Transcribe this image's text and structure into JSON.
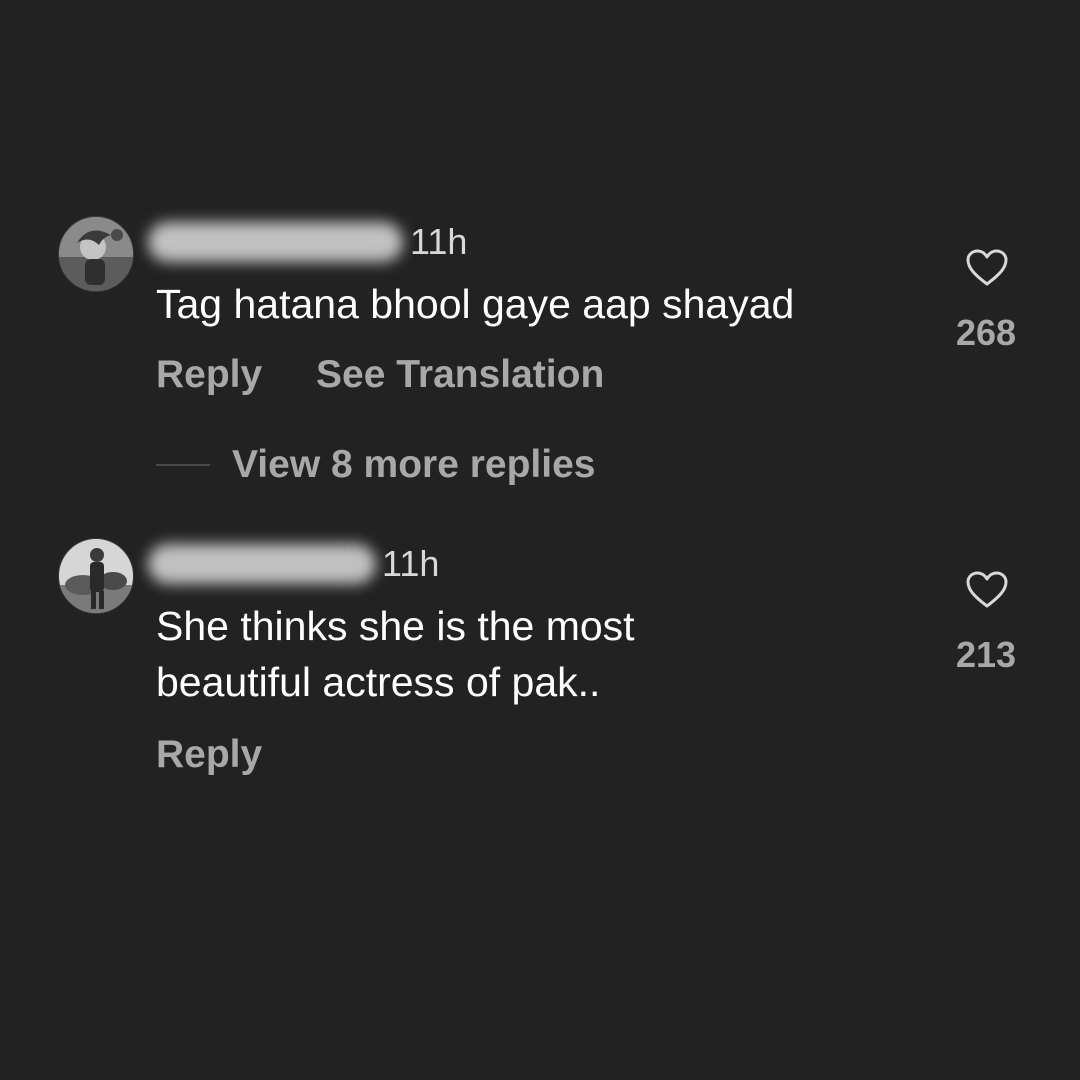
{
  "comments": [
    {
      "timestamp": "11h",
      "text": "Tag hatana bhool gaye aap shayad",
      "actions": {
        "reply": "Reply",
        "translate": "See Translation"
      },
      "likes": "268",
      "view_replies": "View 8 more replies",
      "avatar": "avatar-photo"
    },
    {
      "timestamp": "11h",
      "text_line1": "She thinks she is the most",
      "text_line2": "beautiful actress of pak..",
      "actions": {
        "reply": "Reply"
      },
      "likes": "213",
      "avatar": "avatar-photo"
    }
  ],
  "icons": {
    "like": "heart-outline-icon"
  },
  "colors": {
    "background": "#222222",
    "primary_text": "#ffffff",
    "secondary_text": "#a8a8a8"
  }
}
